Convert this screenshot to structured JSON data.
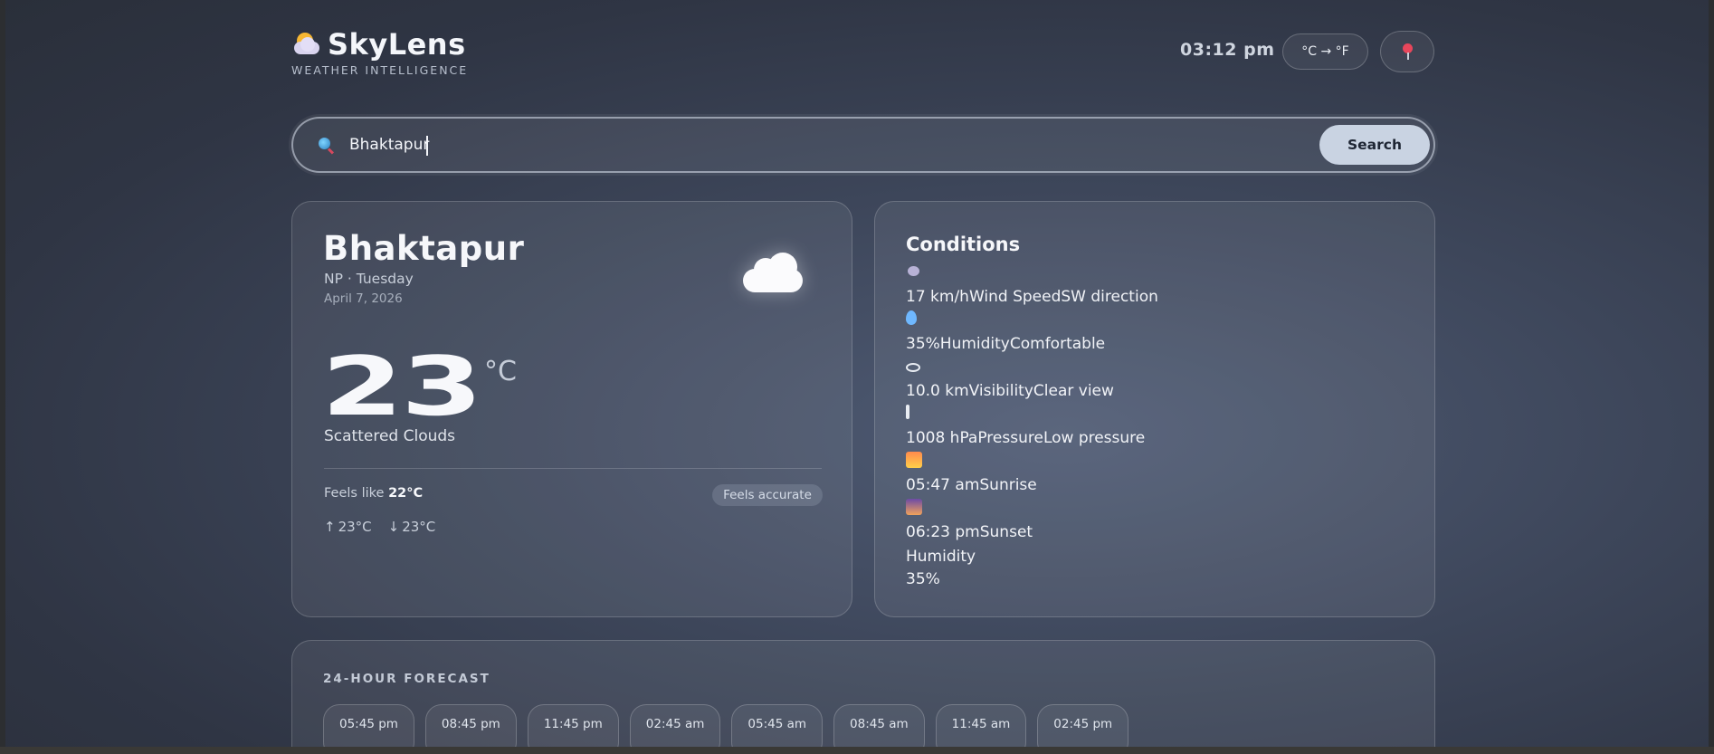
{
  "brand": {
    "name": "SkyLens",
    "tagline": "WEATHER INTELLIGENCE"
  },
  "header": {
    "clock": "03:12 pm",
    "unit_toggle_label": "°C → °F"
  },
  "search": {
    "value": "Bhaktapur",
    "placeholder": "",
    "button_label": "Search"
  },
  "current": {
    "city": "Bhaktapur",
    "country_day": "NP · Tuesday",
    "date": "April 7, 2026",
    "temperature": "23",
    "unit": "°C",
    "description": "Scattered Clouds",
    "feels_like_label": "Feels like",
    "feels_like_value": "22°C",
    "feels_badge": "Feels accurate",
    "high": "23°C",
    "low": "23°C"
  },
  "conditions": {
    "title": "Conditions",
    "items": [
      {
        "icon": "wind-icon",
        "text": "17 km/hWind SpeedSW direction"
      },
      {
        "icon": "drop-icon",
        "text": "35%HumidityComfortable"
      },
      {
        "icon": "eye-icon",
        "text": "10.0 kmVisibilityClear view"
      },
      {
        "icon": "thermometer-icon",
        "text": "1008 hPaPressureLow pressure"
      },
      {
        "icon": "sunrise-icon",
        "text": "05:47 amSunrise"
      },
      {
        "icon": "sunset-icon",
        "text": "06:23 pmSunset"
      }
    ],
    "extra_label": "Humidity",
    "extra_value": "35%"
  },
  "forecast": {
    "title": "24-HOUR FORECAST",
    "hours": [
      "05:45 pm",
      "08:45 pm",
      "11:45 pm",
      "02:45 am",
      "05:45 am",
      "08:45 am",
      "11:45 am",
      "02:45 pm"
    ]
  },
  "colors": {
    "accent_button": "#c9d3e2",
    "background": "#3d465a",
    "pin": "#e8465b"
  }
}
